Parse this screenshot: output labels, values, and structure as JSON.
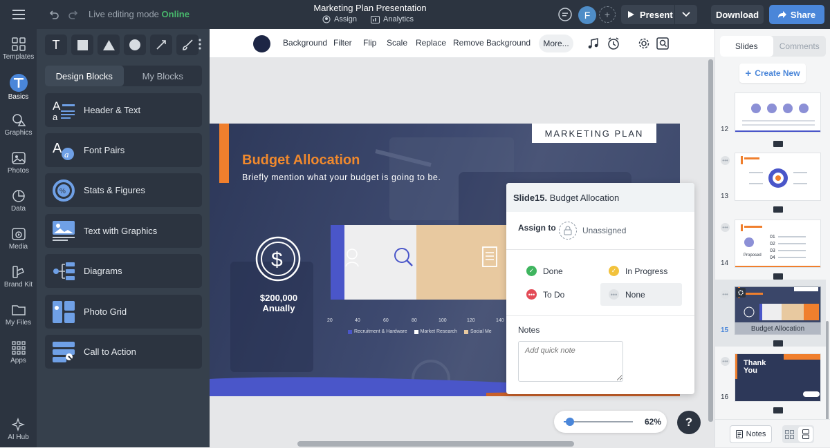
{
  "topbar": {
    "mode_label": "Live editing mode",
    "mode_status": "Online",
    "doc_title": "Marketing Plan Presentation",
    "assign_label": "Assign",
    "analytics_label": "Analytics",
    "avatar_initial": "F",
    "present_label": "Present",
    "download_label": "Download",
    "share_label": "Share"
  },
  "rail": {
    "items": [
      {
        "label": "Templates",
        "icon": "templates-icon"
      },
      {
        "label": "Basics",
        "icon": "text-icon"
      },
      {
        "label": "Graphics",
        "icon": "graphics-icon"
      },
      {
        "label": "Photos",
        "icon": "photos-icon"
      },
      {
        "label": "Data",
        "icon": "pie-chart-icon"
      },
      {
        "label": "Media",
        "icon": "media-icon"
      },
      {
        "label": "Brand Kit",
        "icon": "brand-kit-icon"
      },
      {
        "label": "My Files",
        "icon": "folder-icon"
      },
      {
        "label": "Apps",
        "icon": "apps-icon"
      }
    ],
    "ai_hub_label": "AI Hub"
  },
  "panel": {
    "text_tool_glyph": "T",
    "tab_design": "Design Blocks",
    "tab_my": "My Blocks",
    "blocks": [
      {
        "label": "Header & Text"
      },
      {
        "label": "Font Pairs"
      },
      {
        "label": "Stats & Figures"
      },
      {
        "label": "Text with Graphics"
      },
      {
        "label": "Diagrams"
      },
      {
        "label": "Photo Grid"
      },
      {
        "label": "Call to Action"
      }
    ]
  },
  "imagebar": {
    "swatch_color": "#1d2645",
    "buttons": [
      "Background",
      "Filter",
      "Flip",
      "Scale",
      "Replace",
      "Remove Background"
    ],
    "more_label": "More..."
  },
  "slide": {
    "tag": "MARKETING PLAN",
    "title": "Budget Allocation",
    "subtitle": "Briefly mention what your budget is going to be.",
    "amount_line1": "$200,000",
    "amount_line2": "Anually",
    "axis_ticks": [
      "20",
      "40",
      "60",
      "80",
      "100",
      "120",
      "140"
    ],
    "legend": [
      {
        "label": "Recruitment & Hardware",
        "color": "#4a56c9"
      },
      {
        "label": "Market Research",
        "color": "#ffffff"
      },
      {
        "label": "Social Me",
        "color": "#e8c9a0"
      }
    ],
    "accent": "#f07f2d"
  },
  "popup": {
    "slide_prefix": "Slide15.",
    "slide_name": "Budget Allocation",
    "assign_to_label": "Assign to",
    "assignee": "Unassigned",
    "statuses": [
      {
        "label": "Done",
        "color": "#3fb55f"
      },
      {
        "label": "In Progress",
        "color": "#f2c23c"
      },
      {
        "label": "To Do",
        "color": "#e34b57"
      },
      {
        "label": "None",
        "color": "#dfe2e5"
      }
    ],
    "notes_label": "Notes",
    "note_placeholder": "Add quick note"
  },
  "zoom": {
    "value": "62%",
    "level": 0.1
  },
  "help_label": "?",
  "rightpanel": {
    "tab_slides": "Slides",
    "tab_comments": "Comments",
    "create_new": "Create New",
    "thumbs": [
      {
        "num": "12"
      },
      {
        "num": "13"
      },
      {
        "num": "14"
      },
      {
        "num": "15",
        "caption": "Budget Allocation"
      },
      {
        "num": "16",
        "title_line1": "Thank",
        "title_line2": "You"
      }
    ],
    "notes_button": "Notes"
  }
}
